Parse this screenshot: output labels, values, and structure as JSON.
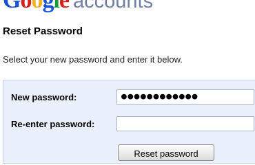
{
  "header": {
    "brand_letters": [
      "G",
      "o",
      "o",
      "g",
      "l",
      "e"
    ],
    "brand_suffix": "accounts"
  },
  "page": {
    "title": "Reset Password",
    "instructions": "Select your new password and enter it below."
  },
  "form": {
    "new_password_label": "New password:",
    "new_password_value": "●●●●●●●●●●●●",
    "reenter_label": "Re-enter password:",
    "reenter_value": "",
    "submit_label": "Reset password"
  },
  "colors": {
    "form_background": "#eaf0fb",
    "brand_blue": "#1a52d6",
    "brand_red": "#d6201e",
    "brand_yellow": "#f2b01e",
    "brand_green": "#189a36",
    "suffix_gray": "#6f7ea6"
  }
}
